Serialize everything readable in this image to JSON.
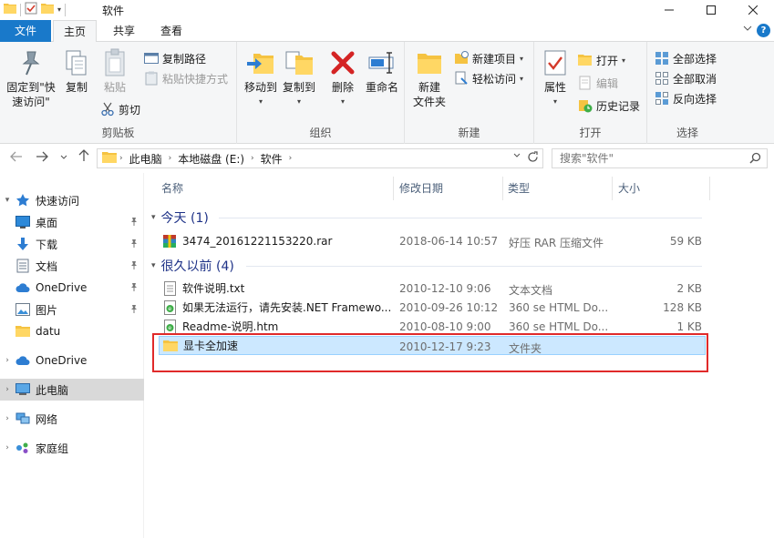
{
  "window": {
    "title": "软件"
  },
  "titlebar": {
    "qat_dropdown": "▾"
  },
  "tabs": {
    "file": "文件",
    "home": "主页",
    "share": "共享",
    "view": "查看",
    "help": "?"
  },
  "ribbon": {
    "clipboard": {
      "group_label": "剪贴板",
      "pin_label_1": "固定到\"快",
      "pin_label_2": "速访问\"",
      "copy": "复制",
      "paste": "粘贴",
      "copy_path": "复制路径",
      "paste_shortcut": "粘贴快捷方式",
      "cut": "剪切"
    },
    "organize": {
      "group_label": "组织",
      "move_to": "移动到",
      "copy_to": "复制到",
      "delete": "删除",
      "rename": "重命名"
    },
    "new": {
      "group_label": "新建",
      "new_folder_1": "新建",
      "new_folder_2": "文件夹",
      "new_item": "新建项目",
      "easy_access": "轻松访问"
    },
    "open": {
      "group_label": "打开",
      "properties": "属性",
      "open": "打开",
      "edit": "编辑",
      "history": "历史记录"
    },
    "select": {
      "group_label": "选择",
      "select_all": "全部选择",
      "select_none": "全部取消",
      "invert": "反向选择"
    }
  },
  "address": {
    "crumbs": [
      "此电脑",
      "本地磁盘 (E:)",
      "软件"
    ],
    "search_placeholder": "搜索\"软件\""
  },
  "nav": {
    "quick_access": "快速访问",
    "desktop": "桌面",
    "downloads": "下载",
    "documents": "文档",
    "onedrive_qa": "OneDrive",
    "pictures": "图片",
    "datu": "datu",
    "onedrive": "OneDrive",
    "this_pc": "此电脑",
    "network": "网络",
    "homegroup": "家庭组"
  },
  "columns": {
    "name": "名称",
    "date": "修改日期",
    "type": "类型",
    "size": "大小"
  },
  "groups": {
    "today": "今天 (1)",
    "long_ago": "很久以前 (4)"
  },
  "files": [
    {
      "name": "3474_20161221153220.rar",
      "date": "2018-06-14 10:57",
      "type": "好压 RAR 压缩文件",
      "size": "59 KB"
    },
    {
      "name": "软件说明.txt",
      "date": "2010-12-10 9:06",
      "type": "文本文档",
      "size": "2 KB"
    },
    {
      "name": "如果无法运行，请先安装.NET Framewo...",
      "date": "2010-09-26 10:12",
      "type": "360 se HTML Do...",
      "size": "128 KB"
    },
    {
      "name": "Readme-说明.htm",
      "date": "2010-08-10 9:00",
      "type": "360 se HTML Do...",
      "size": "1 KB"
    },
    {
      "name": "显卡全加速",
      "date": "2010-12-17 9:23",
      "type": "文件夹",
      "size": ""
    }
  ],
  "colors": {
    "accent": "#1979ca",
    "selection": "#cce8ff",
    "highlight": "#e02a2a",
    "folder": "#f5c342"
  }
}
